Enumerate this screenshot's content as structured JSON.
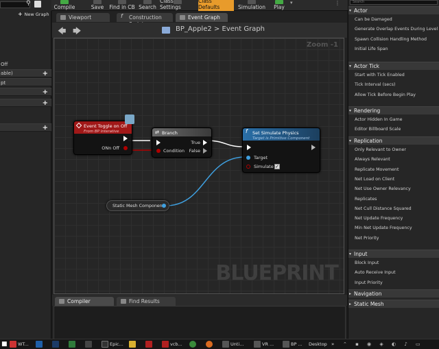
{
  "toolbar": {
    "compile": "Compile",
    "save": "Save",
    "find_in_cb": "Find in CB",
    "search": "Search",
    "class_settings": "Class Settings",
    "class_defaults": "Class Defaults",
    "simulation": "Simulation",
    "play": "Play"
  },
  "left_panel": {
    "new_graph": "New Graph",
    "row_off": "Off",
    "row_able": "able)",
    "row_pt": "pt"
  },
  "tabs": {
    "viewport": "Viewport",
    "construction_script": "Construction Script",
    "event_graph": "Event Graph"
  },
  "breadcrumb": {
    "blueprint": "BP_Apple2",
    "separator": ">",
    "graph": "Event Graph"
  },
  "zoom": "Zoom -1",
  "watermark": "BLUEPRINT",
  "nodes": {
    "event": {
      "title": "Event Toggle on Off",
      "subtitle": "From BP Interative",
      "pin_out": "ONn Off"
    },
    "branch": {
      "title": "Branch",
      "pin_condition": "Condition",
      "pin_true": "True",
      "pin_false": "False"
    },
    "physics": {
      "title": "Set Simulate Physics",
      "subtitle": "Target is Primitive Component",
      "pin_target": "Target",
      "pin_simulate": "Simulate",
      "simulate_checked": true
    },
    "static_mesh": {
      "title": "Static Mesh Component"
    }
  },
  "bottom_tabs": {
    "compiler_results": "Compiler Results",
    "find_results": "Find Results"
  },
  "right_panel": {
    "search_placeholder": "Search",
    "sections": [
      {
        "title": "Actor",
        "items": [
          "Can be Damaged",
          "Generate Overlap Events During Level Str",
          "Spawn Collision Handling Method",
          "Initial Life Span"
        ]
      },
      {
        "title": "Actor Tick",
        "items": [
          "Start with Tick Enabled",
          "Tick Interval (secs)",
          "Allow Tick Before Begin Play"
        ]
      },
      {
        "title": "Rendering",
        "items": [
          "Actor Hidden In Game",
          "Editor Billboard Scale"
        ]
      },
      {
        "title": "Replication",
        "items": [
          "Only Relevant to Owner",
          "Always Relevant",
          "Replicate Movement",
          "Net Load on Client",
          "Net Use Owner Relevancy",
          "Replicates",
          "Net Cull Distance Squared",
          "Net Update Frequency",
          "Min Net Update Frequency",
          "Net Priority"
        ]
      },
      {
        "title": "Input",
        "items": [
          "Block Input",
          "Auto Receive Input",
          "Input Priority"
        ]
      },
      {
        "title": "Navigation",
        "items": []
      },
      {
        "title": "Static Mesh",
        "items": []
      }
    ]
  },
  "taskbar": {
    "items": [
      "WT...",
      "Epic...",
      "vcb...",
      "Unti...",
      "VR ...",
      "BP ...",
      "Desktop"
    ]
  },
  "colors": {
    "accent_orange": "#e89b2b",
    "event_red": "#a01818",
    "physics_blue": "#2a6fa8",
    "wire_blue": "#3fa0e0",
    "wire_red": "#b00000"
  }
}
